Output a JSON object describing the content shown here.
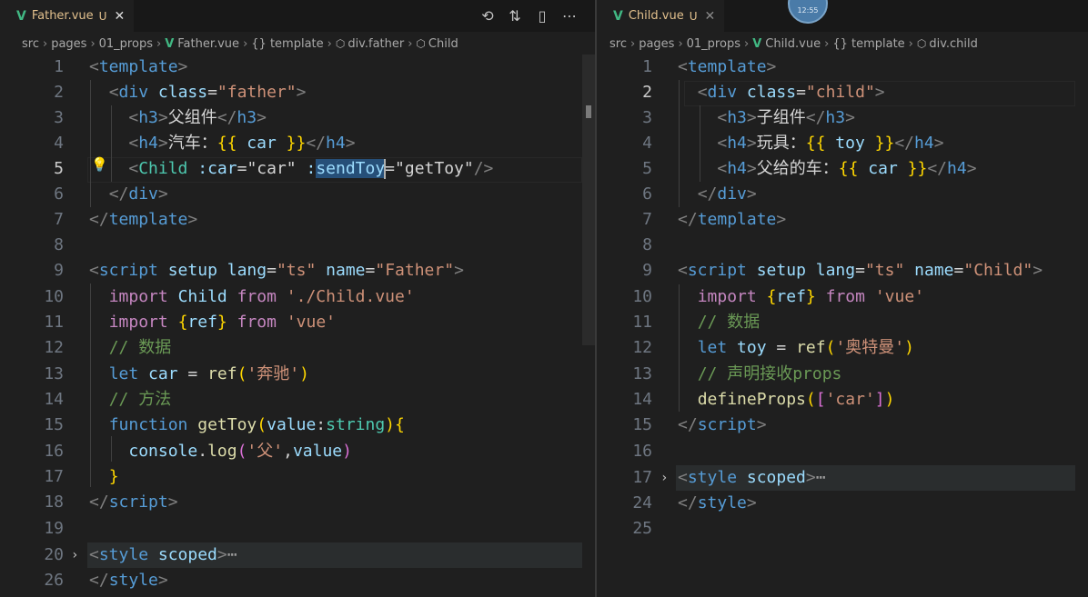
{
  "left": {
    "tab": {
      "name": "Father.vue",
      "status": "U"
    },
    "breadcrumb": [
      "src",
      "pages",
      "01_props",
      "Father.vue",
      "{} template",
      "div.father",
      "Child"
    ],
    "lines": [
      {
        "n": "1"
      },
      {
        "n": "2"
      },
      {
        "n": "3"
      },
      {
        "n": "4"
      },
      {
        "n": "5"
      },
      {
        "n": "6"
      },
      {
        "n": "7"
      },
      {
        "n": "8"
      },
      {
        "n": "9"
      },
      {
        "n": "10"
      },
      {
        "n": "11"
      },
      {
        "n": "12"
      },
      {
        "n": "13"
      },
      {
        "n": "14"
      },
      {
        "n": "15"
      },
      {
        "n": "16"
      },
      {
        "n": "17"
      },
      {
        "n": "18"
      },
      {
        "n": "19"
      },
      {
        "n": "20"
      },
      {
        "n": "26"
      }
    ]
  },
  "right": {
    "tab": {
      "name": "Child.vue",
      "status": "U"
    },
    "clock": "12:55",
    "breadcrumb": [
      "src",
      "pages",
      "01_props",
      "Child.vue",
      "{} template",
      "div.child"
    ],
    "lines": [
      {
        "n": "1"
      },
      {
        "n": "2"
      },
      {
        "n": "3"
      },
      {
        "n": "4"
      },
      {
        "n": "5"
      },
      {
        "n": "6"
      },
      {
        "n": "7"
      },
      {
        "n": "8"
      },
      {
        "n": "9"
      },
      {
        "n": "10"
      },
      {
        "n": "11"
      },
      {
        "n": "12"
      },
      {
        "n": "13"
      },
      {
        "n": "14"
      },
      {
        "n": "15"
      },
      {
        "n": "16"
      },
      {
        "n": "17"
      },
      {
        "n": "24"
      },
      {
        "n": "25"
      }
    ]
  },
  "tokens": {
    "lt": "<",
    "gt": ">",
    "ltslash": "</",
    "slashgt": "/>",
    "eq": "=",
    "template": "template",
    "div": "div",
    "h3": "h3",
    "h4": "h4",
    "script": "script",
    "style": "style",
    "class": "class",
    "q_father": "\"father\"",
    "q_child": "\"child\"",
    "father_cn": "父组件",
    "child_cn": "子组件",
    "car_label": "汽车：",
    "toy_label": "玩具：",
    "fcar_label": "父给的车：",
    "lbrace2": "{{",
    "rbrace2": "}}",
    "car": "car",
    "toy": "toy",
    "Child": "Child",
    "colon_car": ":car",
    "q_car": "\"car\"",
    "colon": ":",
    "sendToy": "sendToy",
    "q_getToy": "\"getToy\"",
    "setup": "setup",
    "lang": "lang",
    "q_ts": "\"ts\"",
    "name": "name",
    "q_Father": "\"Father\"",
    "q_Child": "\"Child\"",
    "import": "import",
    "from": "from",
    "s_childvue": "'./Child.vue'",
    "s_vue": "'vue'",
    "lb": "{",
    "rb": "}",
    "ref": "ref",
    "c_data": "// 数据",
    "let": "let",
    "s_benchi": "'奔驰'",
    "s_aoteman": "'奥特曼'",
    "lp": "(",
    "rp": ")",
    "c_method": "// 方法",
    "function": "function",
    "getToy": "getToy",
    "value": "value",
    "string": "string",
    "console": "console",
    "log": "log",
    "dot": ".",
    "s_fu": "'父'",
    "comma": ",",
    "scoped": "scoped",
    "ellipsis": "⋯",
    "c_declare": "// 声明接收props",
    "defineProps": "defineProps",
    "lsq": "[",
    "rsq": "]",
    "s_car": "'car'",
    "r": "r",
    "ef": "ef"
  }
}
